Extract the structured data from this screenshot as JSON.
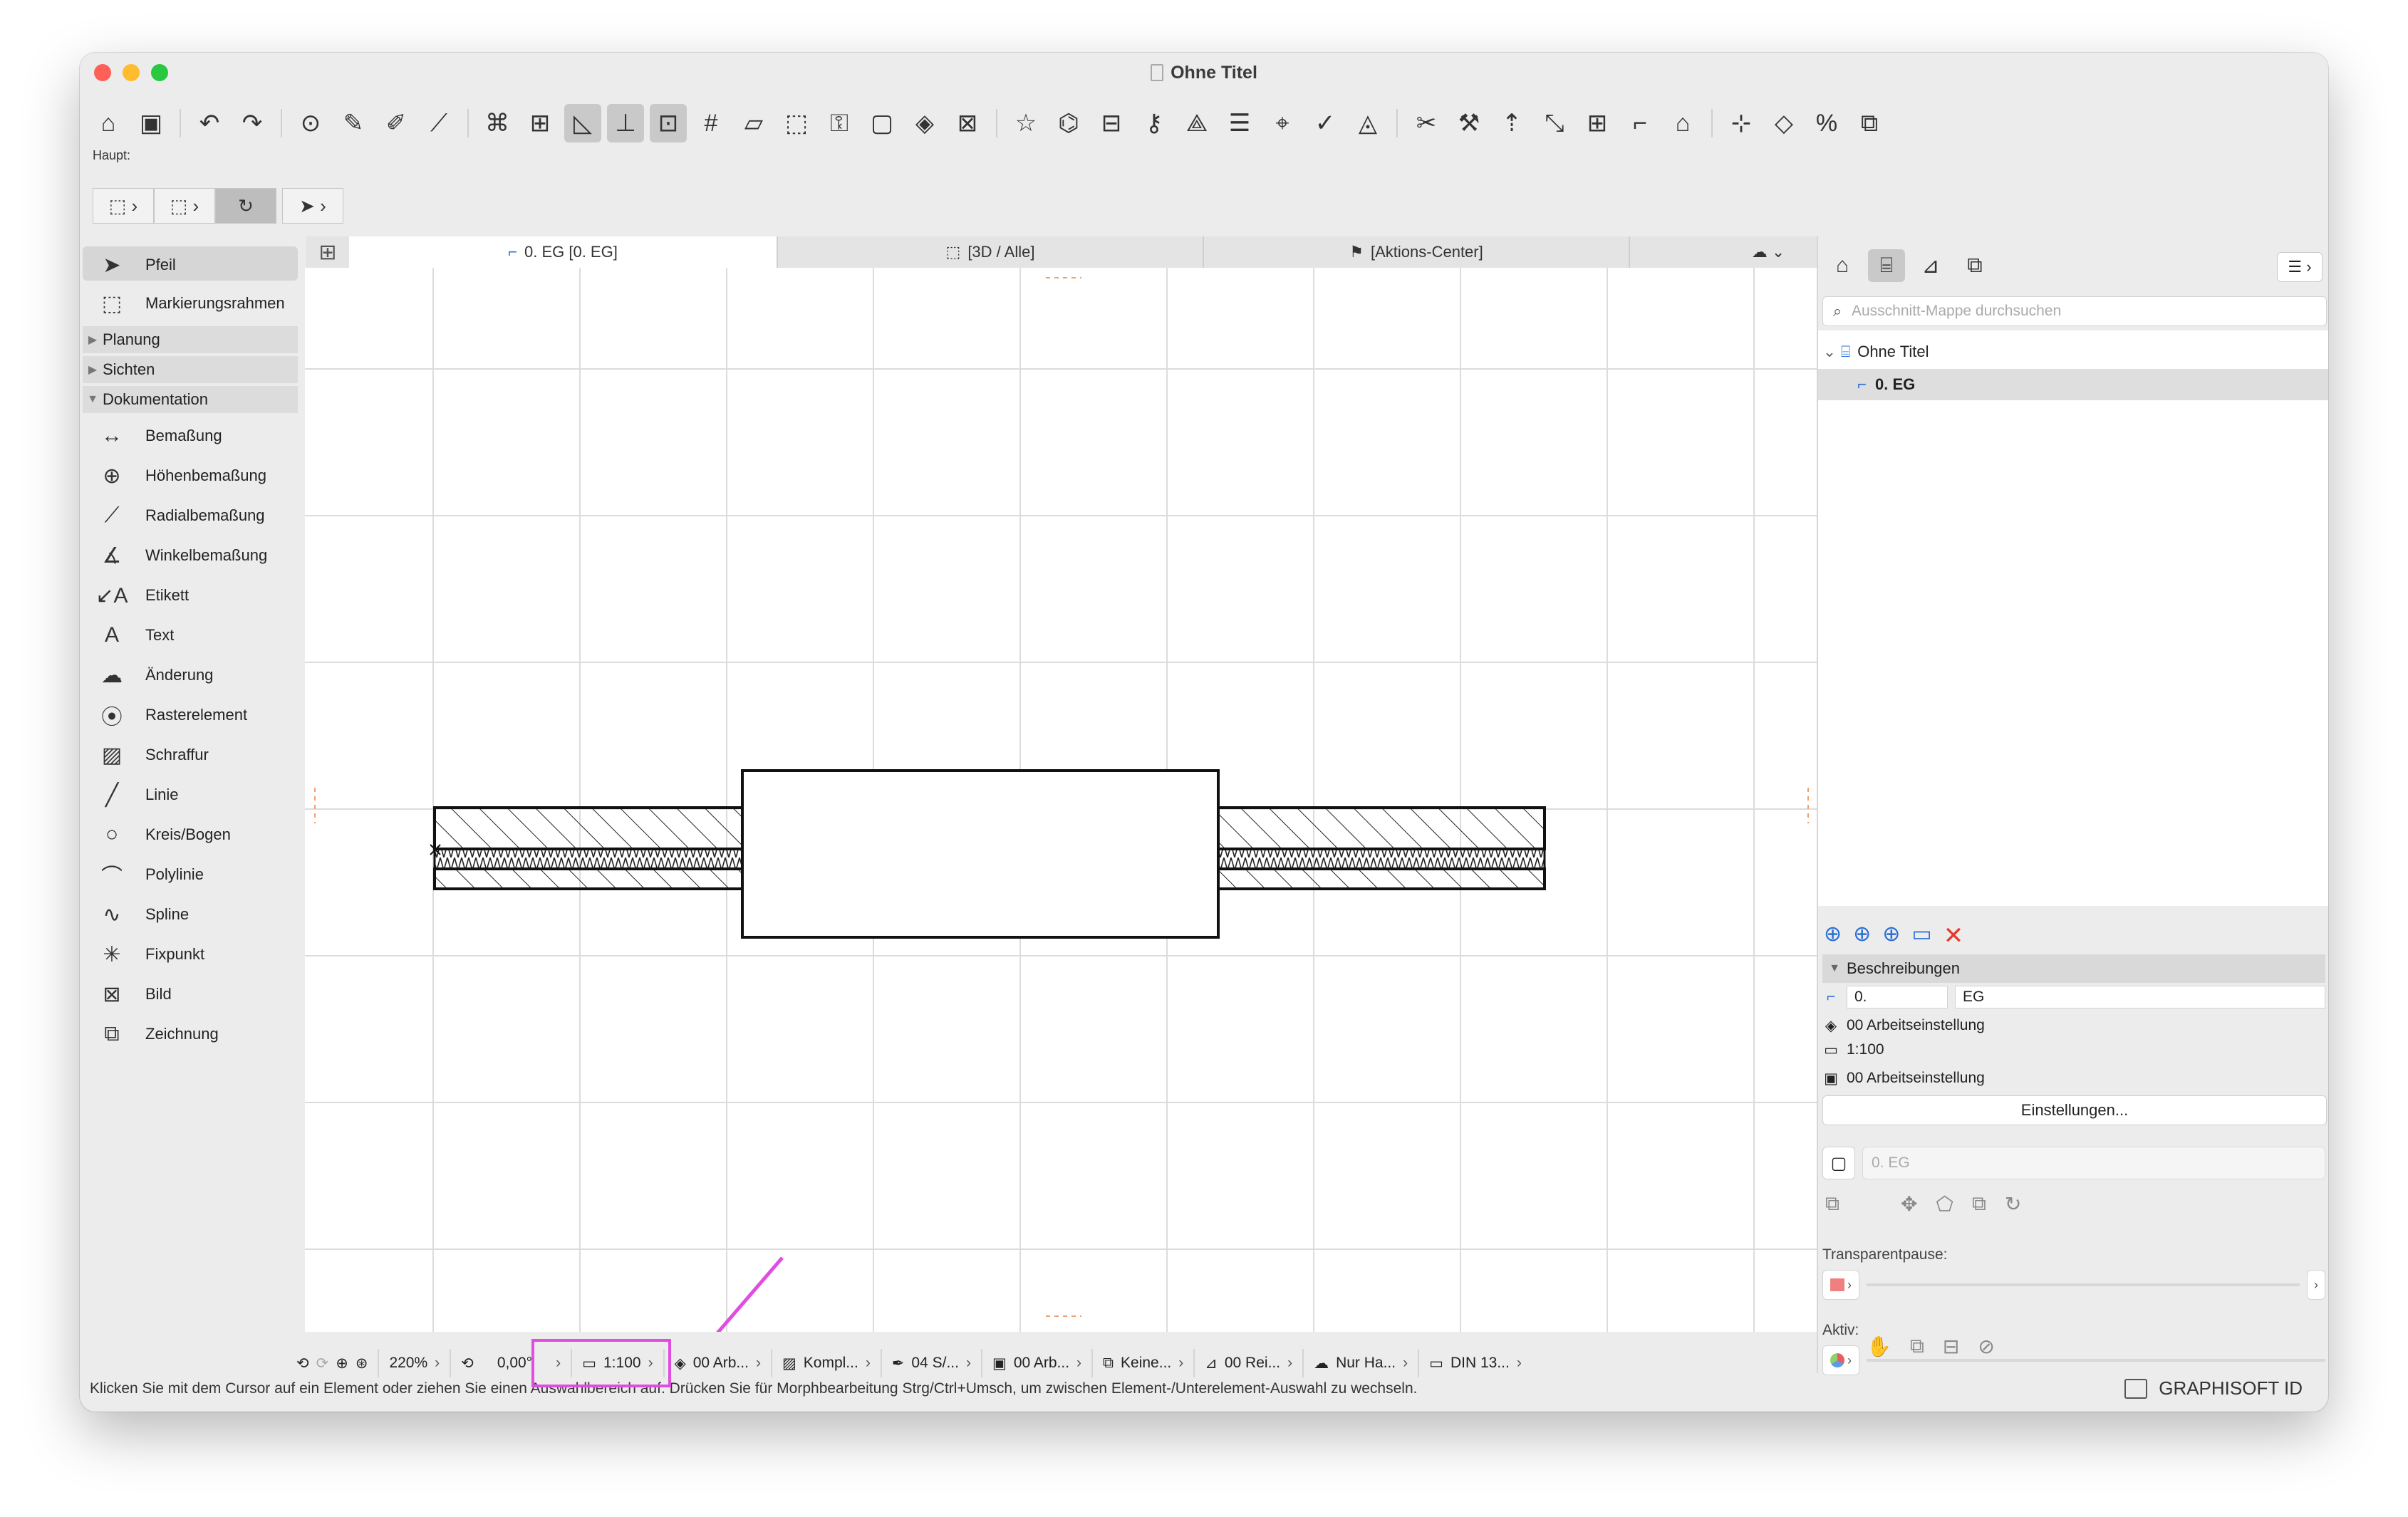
{
  "window": {
    "title": "Ohne Titel"
  },
  "toolbar": {
    "icons": [
      "home-icon",
      "save-icon",
      "undo-icon",
      "redo-icon",
      "find-select-icon",
      "pick-up-icon",
      "inject-icon",
      "magic-wand-icon",
      "trim-icon",
      "renovation-icon",
      "ruler-icon",
      "guide-line-icon",
      "snap-guide-icon",
      "grid-snap-icon",
      "plane-icon",
      "select-region-icon",
      "lock-icon",
      "group-icon",
      "layer-icon",
      "section-icon",
      "star-icon",
      "elevation-icon",
      "interior-elevation-icon",
      "key-icon",
      "3d-icon",
      "list-icon",
      "tag-icon",
      "check-icon",
      "shape-icon",
      "scissors-icon",
      "wrench-icon",
      "move-icon",
      "resize-icon",
      "split-icon",
      "fillet-icon",
      "roof-icon",
      "offset-icon",
      "mirror-icon",
      "percent-icon",
      "copy-icon"
    ]
  },
  "haupt": {
    "label": "Haupt:"
  },
  "sidebar": {
    "active": "Pfeil",
    "items_top": [
      {
        "label": "Pfeil",
        "icon": "arrow-icon"
      },
      {
        "label": "Markierungsrahmen",
        "icon": "marquee-icon"
      }
    ],
    "groups": [
      "Planung",
      "Sichten",
      "Dokumentation"
    ],
    "doc_items": [
      {
        "label": "Bemaßung",
        "icon": "dimension-icon"
      },
      {
        "label": "Höhenbemaßung",
        "icon": "level-dimension-icon"
      },
      {
        "label": "Radialbemaßung",
        "icon": "radial-dimension-icon"
      },
      {
        "label": "Winkelbemaßung",
        "icon": "angle-dimension-icon"
      },
      {
        "label": "Etikett",
        "icon": "label-icon"
      },
      {
        "label": "Text",
        "icon": "text-icon"
      },
      {
        "label": "Änderung",
        "icon": "change-icon"
      },
      {
        "label": "Rasterelement",
        "icon": "grid-element-icon"
      },
      {
        "label": "Schraffur",
        "icon": "hatch-icon"
      },
      {
        "label": "Linie",
        "icon": "line-icon"
      },
      {
        "label": "Kreis/Bogen",
        "icon": "circle-icon"
      },
      {
        "label": "Polylinie",
        "icon": "polyline-icon"
      },
      {
        "label": "Spline",
        "icon": "spline-icon"
      },
      {
        "label": "Fixpunkt",
        "icon": "hotspot-icon"
      },
      {
        "label": "Bild",
        "icon": "image-icon"
      },
      {
        "label": "Zeichnung",
        "icon": "drawing-icon"
      }
    ]
  },
  "tabs": [
    {
      "label": "0. EG [0. EG]",
      "icon": "floor-plan-icon",
      "active": true
    },
    {
      "label": "[3D / Alle]",
      "icon": "3d-box-icon",
      "active": false
    },
    {
      "label": "[Aktions-Center]",
      "icon": "action-center-icon",
      "active": false
    }
  ],
  "statusbar": {
    "zoom": "220%",
    "angle": "0,00°",
    "scale": "1:100",
    "layer": "00 Arb...",
    "structure": "Kompl...",
    "pen": "04 S/...",
    "model_view": "00 Arb...",
    "renovation": "Keine...",
    "dimension": "00 Rei...",
    "filter": "Nur Ha...",
    "paper": "DIN 13..."
  },
  "message": "Klicken Sie mit dem Cursor auf ein Element oder ziehen Sie einen Auswahlbereich auf. Drücken Sie für Morphbearbeitung Strg/Ctrl+Umsch, um zwischen Element-/Unterelement-Auswahl zu wechseln.",
  "brand": "GRAPHISOFT ID",
  "navigator": {
    "search_placeholder": "Ausschnitt-Mappe durchsuchen",
    "menu_label": "☰ ›",
    "tree": [
      {
        "label": "Ohne Titel",
        "level": 0
      },
      {
        "label": "0. EG",
        "level": 1,
        "selected": true
      }
    ],
    "section_title": "Beschreibungen",
    "id_value": "0.",
    "name_value": "EG",
    "layer_combo": "00 Arbeitseinstellung",
    "scale": "1:100",
    "model_view": "00 Arbeitseinstellung",
    "settings_button": "Einstellungen...",
    "story_placeholder": "0. EG",
    "transparent_label": "Transparentpause:",
    "active_label": "Aktiv:"
  },
  "colors": {
    "accent_blue": "#2a6fd6",
    "delete_red": "#e23b2e",
    "highlight_magenta": "#e04de0"
  }
}
